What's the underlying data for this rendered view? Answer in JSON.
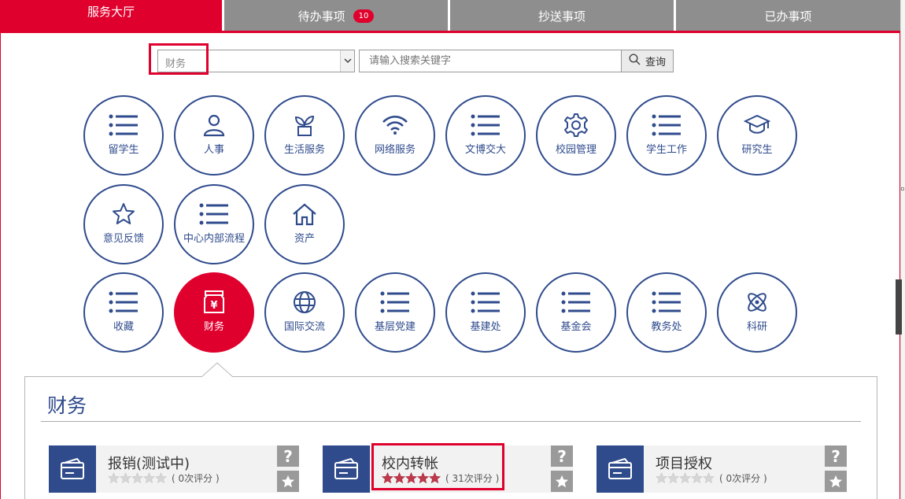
{
  "tabs": [
    {
      "label": "服务大厅",
      "active": true
    },
    {
      "label": "待办事项",
      "badge": "10"
    },
    {
      "label": "抄送事项"
    },
    {
      "label": "已办事项"
    }
  ],
  "search": {
    "category_value": "财务",
    "placeholder": "请输入搜索关键字",
    "button_label": "查询"
  },
  "categories": [
    {
      "label": "留学生",
      "icon": "list-icon"
    },
    {
      "label": "人事",
      "icon": "person-icon"
    },
    {
      "label": "生活服务",
      "icon": "plant-icon"
    },
    {
      "label": "网络服务",
      "icon": "wifi-icon"
    },
    {
      "label": "文博交大",
      "icon": "list-icon"
    },
    {
      "label": "校园管理",
      "icon": "gear-icon"
    },
    {
      "label": "学生工作",
      "icon": "list-icon"
    },
    {
      "label": "研究生",
      "icon": "graduation-cap-icon"
    },
    {
      "label": "意见反馈",
      "icon": "star-icon"
    },
    {
      "label": "中心内部流程",
      "icon": "list-icon"
    },
    {
      "label": "资产",
      "icon": "house-icon"
    },
    {
      "label": "收藏",
      "icon": "list-icon"
    },
    {
      "label": "财务",
      "icon": "money-bag-icon",
      "active": true
    },
    {
      "label": "国际交流",
      "icon": "globe-icon"
    },
    {
      "label": "基层党建",
      "icon": "list-icon"
    },
    {
      "label": "基建处",
      "icon": "list-icon"
    },
    {
      "label": "基金会",
      "icon": "list-icon"
    },
    {
      "label": "教务处",
      "icon": "list-icon"
    },
    {
      "label": "科研",
      "icon": "atom-icon"
    }
  ],
  "panel": {
    "title": "财务",
    "services": [
      {
        "name": "报销(测试中)",
        "rating": "( 0次评分 )",
        "stars": 0,
        "question": "?"
      },
      {
        "name": "校内转帐",
        "rating": "( 31次评分 )",
        "stars": 5,
        "question": "?"
      },
      {
        "name": "项目授权",
        "rating": "( 0次评分 )",
        "stars": 0,
        "question": "?"
      }
    ]
  },
  "colors": {
    "accent": "#e0002d",
    "navy": "#2f4b8c",
    "tab_gray": "#8e8e8e"
  }
}
